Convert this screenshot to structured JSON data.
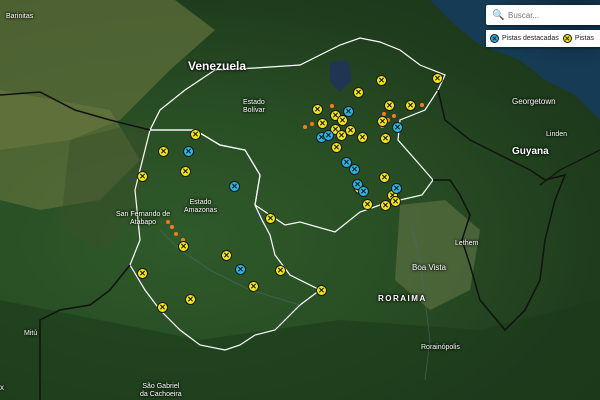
{
  "search": {
    "placeholder": "Buscar..."
  },
  "legend": {
    "featured_label": "Pistas destacadas",
    "other_label": "Pistas"
  },
  "colors": {
    "featured": "#29b6e6",
    "airstrip": "#f2e51a",
    "fire": "#ff7a1f",
    "border": "#ffffff"
  },
  "icons": {
    "marker": "airplane-icon",
    "search": "search-icon"
  },
  "labels": {
    "barinitas": "Barinitas",
    "venezuela": "Venezuela",
    "estado_bolivar": "Estado\nBolívar",
    "georgetown": "Georgetown",
    "linden": "Linden",
    "guyana": "Guyana",
    "san_fernando": "San Fernando de\nAtabapo",
    "estado_amazonas": "Estado\nAmazonas",
    "lethem": "Lethem",
    "boa_vista": "Boa Vista",
    "roraima": "RORAIMA",
    "roraimopolis": "Rorainópolis",
    "mitu": "Mitú",
    "sao_gabriel": "São Gabriel\nda Cachoeira",
    "edge_x": "x"
  }
}
